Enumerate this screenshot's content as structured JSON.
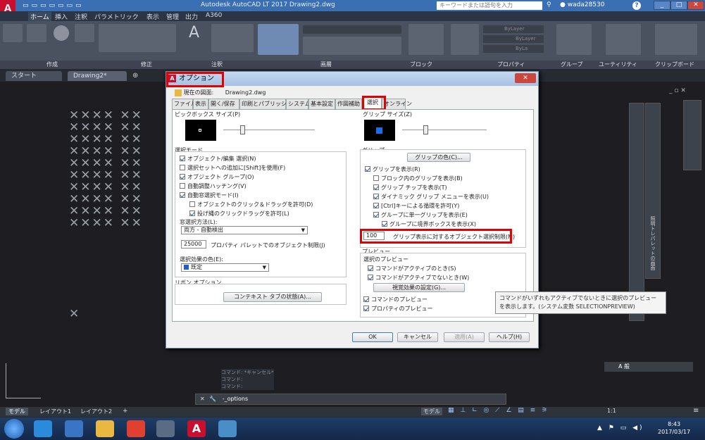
{
  "window": {
    "title": "Autodesk AutoCAD LT 2017    Drawing2.dwg",
    "search_placeholder": "キーワードまたは語句を入力",
    "user": "wada28530"
  },
  "menu": [
    "ホーム",
    "挿入",
    "注釈",
    "パラメトリック",
    "表示",
    "管理",
    "出力",
    "A360"
  ],
  "panel_labels": [
    "作成",
    "修正",
    "注釈",
    "画層",
    "ブロック",
    "プロパティ",
    "グループ",
    "ユーティリティ",
    "クリップボード"
  ],
  "ribbon_layer": {
    "color": "ByLayer",
    "linetype": "ByLayer",
    "lineweight": "ByLa"
  },
  "file_tabs": [
    "スタート",
    "Drawing2*"
  ],
  "dialog": {
    "title": "オプション",
    "current_profile_label": "現在の図面:",
    "current_profile_value": "Drawing2.dwg",
    "tabs": [
      "ファイル",
      "表示",
      "開く/保存",
      "印刷とパブリッシュ",
      "システム",
      "基本設定",
      "作図補助",
      "選択",
      "オンライン"
    ],
    "active_tab": "選択",
    "left": {
      "pickbox_label": "ピックボックス サイズ(P)",
      "selection_modes_label": "選択モード",
      "modes": [
        {
          "label": "オブジェクト/編集 選択(N)",
          "checked": true
        },
        {
          "label": "選択セットへの追加に[Shift]を使用(F)",
          "checked": false
        },
        {
          "label": "オブジェクト グループ(O)",
          "checked": true
        },
        {
          "label": "自動調整ハッチング(V)",
          "checked": false
        },
        {
          "label": "自動窓選択モード(I)",
          "checked": true
        },
        {
          "label": "オブジェクトのクリック＆ドラッグを許可(D)",
          "checked": false
        },
        {
          "label": "投げ縄のクリックドラッグを許可(L)",
          "checked": true
        }
      ],
      "window_method_label": "窓選択方法(L):",
      "window_method_value": "両方 - 自動検出",
      "prop_limit_value": "25000",
      "prop_limit_label": "プロパティ パレットでのオブジェクト制限(J)",
      "effect_color_label": "選択効果の色(E):",
      "effect_color_value": "既定",
      "ribbon_options_label": "リボン オプション",
      "contextual_tab_button": "コンテキスト タブの状態(A)..."
    },
    "right": {
      "grip_size_label": "グリップ サイズ(Z)",
      "grips_label": "グリップ",
      "grip_colors_button": "グリップの色(C)...",
      "grip_options": [
        {
          "label": "グリップを表示(R)",
          "checked": true
        },
        {
          "label": "ブロック内のグリップを表示(B)",
          "checked": false
        },
        {
          "label": "グリップ チップを表示(T)",
          "checked": true
        },
        {
          "label": "ダイナミック グリップ メニューを表示(U)",
          "checked": true
        },
        {
          "label": "[Ctrl]キーによる循環を許可(Y)",
          "checked": true
        },
        {
          "label": "グループに単一グリップを表示(E)",
          "checked": true
        },
        {
          "label": "グループに境界ボックスを表示(X)",
          "checked": true
        }
      ],
      "object_limit_value": "100",
      "object_limit_label": "グリップ表示に対するオブジェクト選択制限(M)",
      "preview_label": "プレビュー",
      "selection_preview_label": "選択のプレビュー",
      "preview_options": [
        {
          "label": "コマンドがアクティブのとき(S)",
          "checked": true
        },
        {
          "label": "コマンドがアクティブでないとき(W)",
          "checked": true
        }
      ],
      "visual_effects_button": "視覚効果の設定(G)...",
      "command_preview": {
        "label": "コマンドのプレビュー",
        "checked": true
      },
      "property_preview": {
        "label": "プロパティのプレビュー",
        "checked": true
      }
    },
    "buttons": {
      "ok": "OK",
      "cancel": "キャンセル",
      "apply": "適用(A)",
      "help": "ヘルプ(H)"
    }
  },
  "tooltip": "コマンドがいずれもアクティブでないときに選択のプレビューを表示します。(システム変数 SELECTIONPREVIEW)",
  "command_history": [
    "コマンド: *キャンセル*",
    "コマンド:",
    "コマンド:"
  ],
  "command_input": "-_options",
  "layout_tabs": [
    "モデル",
    "レイアウト1",
    "レイアウト2"
  ],
  "status_model": "モデル",
  "status_scale": "1:1",
  "palette_title": "照明トレパレットの画面",
  "tray_ime": "A 般",
  "clock": {
    "time": "8:43",
    "date": "2017/03/17"
  },
  "accent_colors": {
    "highlight_red": "#e30000",
    "autocad_red": "#c8102e",
    "titlebar": "#3b6fb3"
  }
}
